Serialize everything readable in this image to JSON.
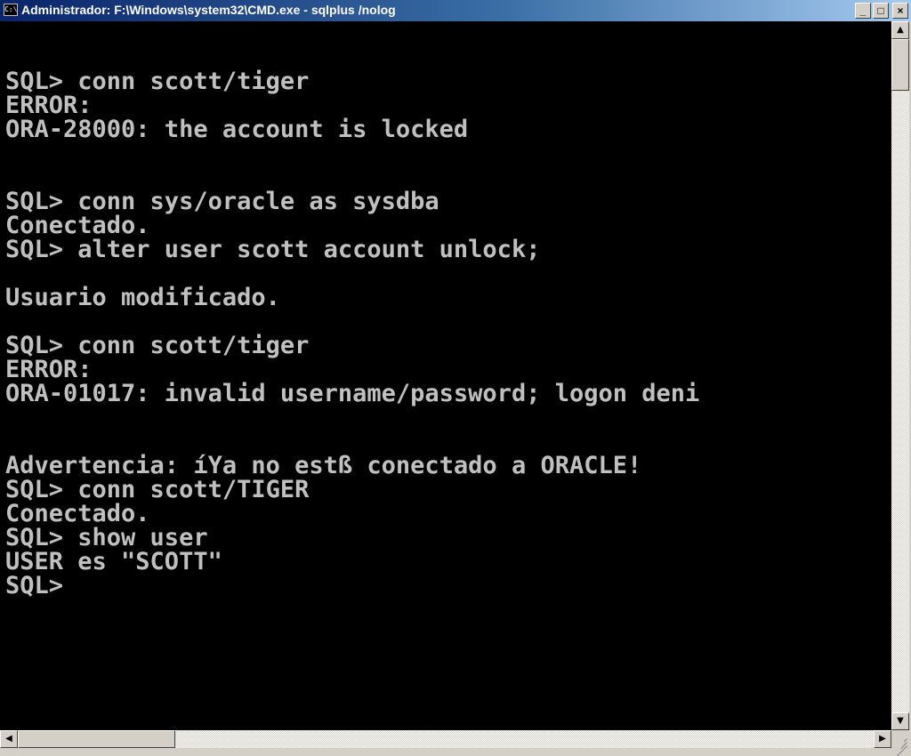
{
  "window": {
    "title": "Administrador: F:\\Windows\\system32\\CMD.exe - sqlplus  /nolog",
    "icon_label": "C:\\",
    "controls": {
      "minimize": "_",
      "maximize": "□",
      "close": "×"
    }
  },
  "console": {
    "text_color": "#c0c0c0",
    "background": "#000000",
    "lines": [
      "SQL> conn scott/tiger",
      "ERROR:",
      "ORA-28000: the account is locked",
      "",
      "",
      "SQL> conn sys/oracle as sysdba",
      "Conectado.",
      "SQL> alter user scott account unlock;",
      "",
      "Usuario modificado.",
      "",
      "SQL> conn scott/tiger",
      "ERROR:",
      "ORA-01017: invalid username/password; logon deni",
      "",
      "",
      "Advertencia: íYa no estß conectado a ORACLE!",
      "SQL> conn scott/TIGER",
      "Conectado.",
      "SQL> show user",
      "USER es \"SCOTT\"",
      "SQL>"
    ]
  },
  "scrollbars": {
    "up_arrow": "▲",
    "down_arrow": "▼",
    "left_arrow": "◀",
    "right_arrow": "▶"
  }
}
